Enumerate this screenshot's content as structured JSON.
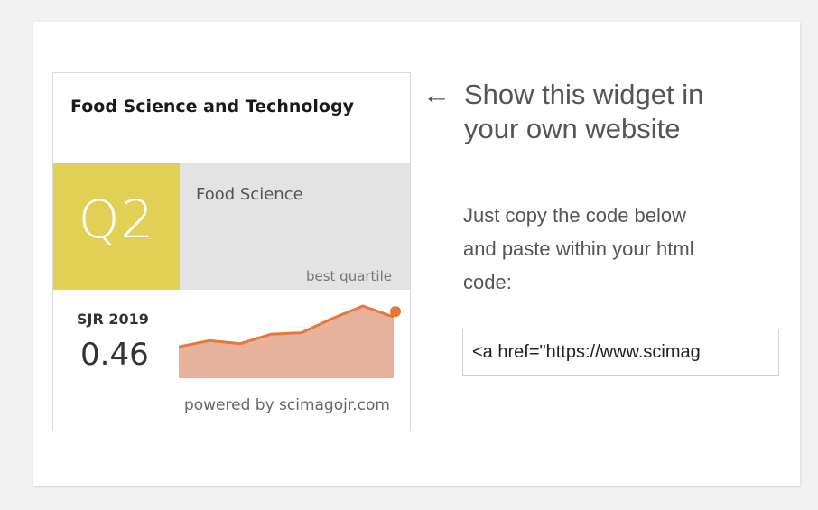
{
  "widget": {
    "journal_title": "Food Science and Technology",
    "quartile": "Q2",
    "category": "Food Science",
    "best_quartile_label": "best quartile",
    "sjr_label": "SJR 2019",
    "sjr_value": "0.46",
    "powered_by": "powered by scimagojr.com",
    "colors": {
      "quartile_bg": "#e2cf55",
      "category_bg": "#e3e3e3",
      "sparkline_line": "#e8773b",
      "sparkline_fill": "#e8b39c"
    },
    "sparkline_values": [
      0.2,
      0.24,
      0.22,
      0.28,
      0.29,
      0.38,
      0.46,
      0.39
    ]
  },
  "promo": {
    "arrow": "←",
    "headline_line1": "Show this widget in",
    "headline_line2": "your own website",
    "instruction_line1": "Just copy the code below",
    "instruction_line2": "and paste within your html",
    "instruction_line3": "code:",
    "embed_code": "<a href=\"https://www.scimag"
  }
}
